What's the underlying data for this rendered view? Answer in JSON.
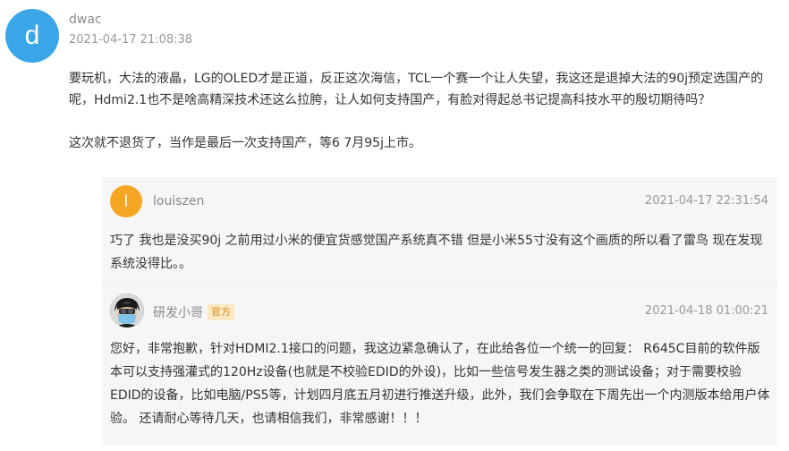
{
  "comment": {
    "avatar_letter": "d",
    "avatar_color": "#3aa6e8",
    "username": "dwac",
    "timestamp": "2021-04-17 21:08:38",
    "paragraphs": [
      "要玩机，大法的液晶，LG的OLED才是正道，反正这次海信，TCL一个赛一个让人失望，我这还是退掉大法的90j预定选国产的呢，Hdmi2.1也不是啥高精深技术还这么拉胯，让人如何支持国产，有脸对得起总书记提高科技水平的殷切期待吗？",
      "这次就不退货了，当作是最后一次支持国产，等6 7月95j上市。"
    ]
  },
  "replies": [
    {
      "avatar_letter": "l",
      "avatar_color": "#f5a623",
      "username": "louiszen",
      "timestamp": "2021-04-17 22:31:54",
      "text": "巧了 我也是没买90j 之前用过小米的便宜货感觉国产系统真不错 但是小米55寸没有这个画质的所以看了雷鸟 现在发现系统没得比。。"
    },
    {
      "avatar_icon": "masked-person-avatar",
      "username": "研发小哥",
      "badge": "官方",
      "timestamp": "2021-04-18 01:00:21",
      "text": "您好，非常抱歉，针对HDMI2.1接口的问题，我这边紧急确认了，在此给各位一个统一的回复： R645C目前的软件版本可以支持强灌式的120Hz设备(也就是不校验EDID的外设)，比如一些信号发生器之类的测试设备；对于需要校验EDID的设备，比如电脑/PS5等，计划四月底五月初进行推送升级，此外，我们会争取在下周先出一个内测版本给用户体验。 还请耐心等待几天，也请相信我们，非常感谢！！！"
    }
  ]
}
